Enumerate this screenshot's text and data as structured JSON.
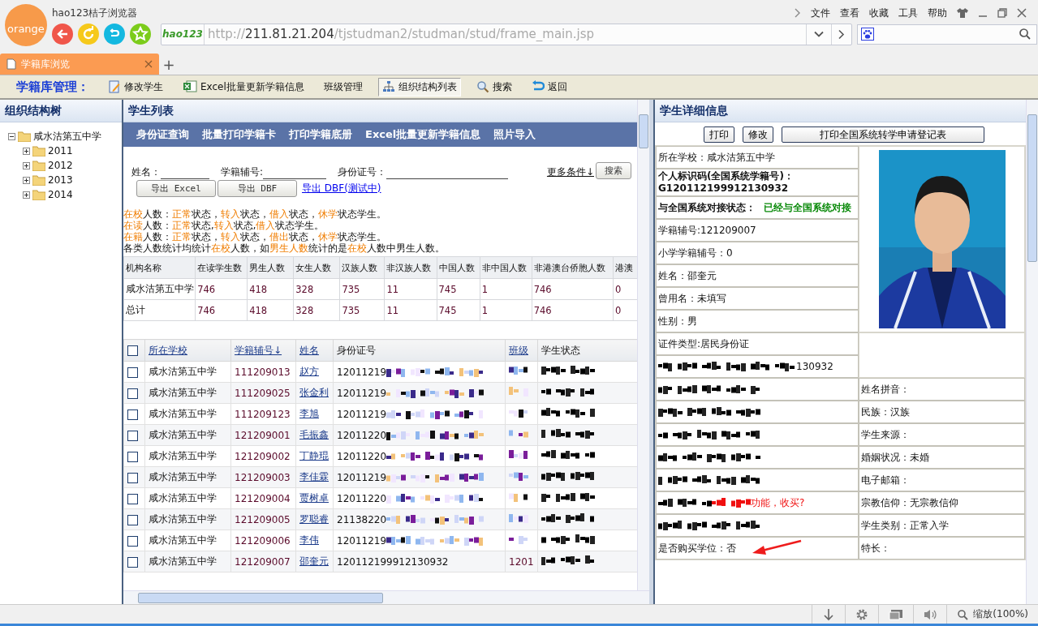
{
  "browser": {
    "logo": "orange",
    "title": "hao123桔子浏览器",
    "badge": "hao123",
    "address": {
      "scheme": "http://",
      "host": "211.81.21.204",
      "path": "/tjstudman2/studman/stud/frame_main.jsp"
    },
    "menu": [
      "文件",
      "查看",
      "收藏",
      "工具",
      "帮助"
    ],
    "tabs": [
      {
        "label": "学籍库浏览",
        "selected": true
      }
    ],
    "new_tab": "+",
    "zoom": "缩放(100%)"
  },
  "toolbar": {
    "title": "学籍库管理：",
    "items": [
      {
        "label": "修改学生",
        "selected": false
      },
      {
        "label": "Excel批量更新学籍信息",
        "selected": false
      },
      {
        "label": "班级管理",
        "selected": false
      },
      {
        "label": "组织结构列表",
        "selected": true
      },
      {
        "label": "搜索",
        "selected": false
      },
      {
        "label": "返回",
        "selected": false
      }
    ]
  },
  "tree": {
    "title": "组织结构树",
    "root": {
      "label": "咸水沽第五中学",
      "expanded": true,
      "children": [
        {
          "label": "2011",
          "expanded": false
        },
        {
          "label": "2012",
          "expanded": false
        },
        {
          "label": "2013",
          "expanded": false
        },
        {
          "label": "2014",
          "expanded": false
        }
      ]
    }
  },
  "list": {
    "title": "学生列表",
    "actions": [
      "身份证查询",
      "批量打印学籍卡",
      "打印学籍底册",
      "Excel批量更新学籍信息",
      "照片导入"
    ],
    "filters": [
      "姓名：",
      "学籍辅号:",
      "身份证号："
    ],
    "more": "更多条件↓",
    "search": "搜索",
    "exports": [
      "导出 Excel",
      "导出 DBF"
    ],
    "export_link": "导出 DBF(测试中)",
    "notes": [
      [
        {
          "t": "在校",
          "hl": true
        },
        {
          "t": "人数：",
          "hl": false
        },
        {
          "t": "正常",
          "hl": true
        },
        {
          "t": "状态，",
          "hl": false
        },
        {
          "t": "转入",
          "hl": true
        },
        {
          "t": "状态，",
          "hl": false
        },
        {
          "t": "借入",
          "hl": true
        },
        {
          "t": "状态，",
          "hl": false
        },
        {
          "t": "休学",
          "hl": true
        },
        {
          "t": "状态学生。",
          "hl": false
        }
      ],
      [
        {
          "t": "在读",
          "hl": true
        },
        {
          "t": "人数：",
          "hl": false
        },
        {
          "t": "正常",
          "hl": true
        },
        {
          "t": "状态,",
          "hl": false
        },
        {
          "t": "转入",
          "hl": true
        },
        {
          "t": "状态,",
          "hl": false
        },
        {
          "t": "借入",
          "hl": true
        },
        {
          "t": "状态学生。",
          "hl": false
        }
      ],
      [
        {
          "t": "在籍",
          "hl": true
        },
        {
          "t": "人数：",
          "hl": false
        },
        {
          "t": "正常",
          "hl": true
        },
        {
          "t": "状态，",
          "hl": false
        },
        {
          "t": "转入",
          "hl": true
        },
        {
          "t": "状态，",
          "hl": false
        },
        {
          "t": "借出",
          "hl": true
        },
        {
          "t": "状态，",
          "hl": false
        },
        {
          "t": "休学",
          "hl": true
        },
        {
          "t": "状态学生。",
          "hl": false
        }
      ],
      [
        {
          "t": "各类人数统计均统计",
          "hl": false
        },
        {
          "t": "在校",
          "hl": true
        },
        {
          "t": "人数，如",
          "hl": false
        },
        {
          "t": "男生人数",
          "hl": true
        },
        {
          "t": "统计的是",
          "hl": false
        },
        {
          "t": "在校",
          "hl": true
        },
        {
          "t": "人数中男生人数。",
          "hl": false
        }
      ]
    ],
    "stats": {
      "columns": [
        "机构名称",
        "在读学生数",
        "男生人数",
        "女生人数",
        "汉族人数",
        "非汉族人数",
        "中国人数",
        "非中国人数",
        "非港澳台侨胞人数",
        "港澳"
      ],
      "rows": [
        [
          "咸水沽第五中学",
          "746",
          "418",
          "328",
          "735",
          "11",
          "745",
          "1",
          "746",
          "0"
        ],
        [
          "总计",
          "746",
          "418",
          "328",
          "735",
          "11",
          "745",
          "1",
          "746",
          "0"
        ]
      ]
    },
    "columns": [
      {
        "label": "所在学校",
        "link": true
      },
      {
        "label": "学籍辅号↓",
        "link": true
      },
      {
        "label": "姓名",
        "link": true
      },
      {
        "label": "身份证号",
        "link": false
      },
      {
        "label": "班级",
        "link": true
      },
      {
        "label": "学生状态",
        "link": false
      }
    ],
    "all_checked": false,
    "rows": [
      {
        "checked": false,
        "school": "咸水沽第五中学",
        "no": "111209013",
        "name": "赵方",
        "id": "12011219",
        "id_hidden": true
      },
      {
        "checked": false,
        "school": "咸水沽第五中学",
        "no": "111209025",
        "name": "张金利",
        "id": "12011219",
        "id_hidden": true
      },
      {
        "checked": false,
        "school": "咸水沽第五中学",
        "no": "111209123",
        "name": "李旭",
        "id": "12011219",
        "id_hidden": true
      },
      {
        "checked": false,
        "school": "咸水沽第五中学",
        "no": "121209001",
        "name": "毛振鑫",
        "id": "12011220",
        "id_hidden": true
      },
      {
        "checked": false,
        "school": "咸水沽第五中学",
        "no": "121209002",
        "name": "丁静琨",
        "id": "12011220",
        "id_hidden": true
      },
      {
        "checked": false,
        "school": "咸水沽第五中学",
        "no": "121209003",
        "name": "李佳霖",
        "id": "12011219",
        "id_hidden": true
      },
      {
        "checked": false,
        "school": "咸水沽第五中学",
        "no": "121209004",
        "name": "贾树卓",
        "id": "12011220",
        "id_hidden": true
      },
      {
        "checked": false,
        "school": "咸水沽第五中学",
        "no": "121209005",
        "name": "罗聪睿",
        "id": "21138220",
        "id_hidden": true
      },
      {
        "checked": false,
        "school": "咸水沽第五中学",
        "no": "121209006",
        "name": "李伟",
        "id": "12011219",
        "id_hidden": true
      },
      {
        "checked": false,
        "school": "咸水沽第五中学",
        "no": "121209007",
        "name": "邵奎元",
        "id": "120112199912130932",
        "id_hidden": false,
        "class": "1201"
      }
    ]
  },
  "detail": {
    "title": "学生详细信息",
    "buttons": [
      "打印",
      "修改",
      "打印全国系统转学申请登记表"
    ],
    "top_rows": [
      {
        "kind": "plain",
        "text": "所在学校：咸水沽第五中学"
      },
      {
        "kind": "bold",
        "text": "个人标识码(全国系统学籍号)：G120112199912130932"
      },
      {
        "kind": "status",
        "label": "与全国系统对接状态：",
        "value": "已经与全国系统对接"
      },
      {
        "kind": "plain",
        "text": "学籍辅号:121209007"
      },
      {
        "kind": "plain",
        "text": "小学学籍辅号：0"
      },
      {
        "kind": "plain",
        "text": "姓名：邵奎元"
      },
      {
        "kind": "plain",
        "text": "曾用名：未填写"
      },
      {
        "kind": "plain",
        "text": "性别：男"
      }
    ],
    "mid_rows": [
      {
        "kind": "plain",
        "text": "证件类型:居民身份证"
      },
      {
        "kind": "redacted_tail",
        "text": "130932"
      }
    ],
    "bottom_rows": [
      {
        "left": {
          "kind": "redacted"
        },
        "right": "姓名拼音："
      },
      {
        "left": {
          "kind": "redacted"
        },
        "right": "民族：汉族"
      },
      {
        "left": {
          "kind": "redacted"
        },
        "right": "学生来源："
      },
      {
        "left": {
          "kind": "redacted"
        },
        "right": "婚姻状况：未婚"
      },
      {
        "left": {
          "kind": "redacted"
        },
        "right": "电子邮箱："
      },
      {
        "left": {
          "kind": "redacted_note",
          "text": "功能，收买?"
        },
        "right": "宗教信仰：无宗教信仰"
      },
      {
        "left": {
          "kind": "redacted"
        },
        "right": "学生类别：正常入学"
      },
      {
        "left": {
          "kind": "plain",
          "text": "是否购买学位：否",
          "arrow": true
        },
        "right": "特长："
      }
    ]
  }
}
